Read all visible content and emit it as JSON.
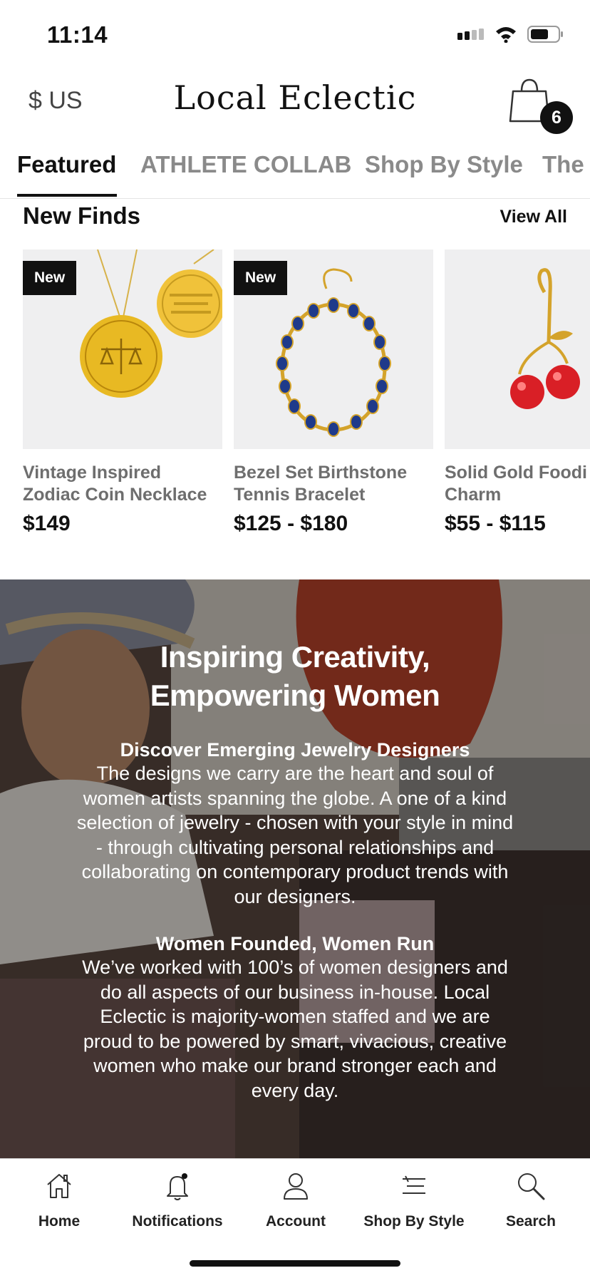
{
  "status_bar": {
    "time": "11:14"
  },
  "header": {
    "currency": "$ US",
    "brand": "Local Eclectic",
    "cart_count": "6"
  },
  "tabs": [
    {
      "label": "Featured"
    },
    {
      "label": "ATHLETE COLLAB"
    },
    {
      "label": "Shop By Style"
    },
    {
      "label": "The"
    }
  ],
  "new_finds": {
    "title": "New Finds",
    "view_all": "View All",
    "products": [
      {
        "badge": "New",
        "name_line1": "Vintage Inspired",
        "name_line2": "Zodiac Coin Necklace",
        "price": "$149"
      },
      {
        "badge": "New",
        "name_line1": "Bezel Set Birthstone",
        "name_line2": "Tennis Bracelet",
        "price": "$125 - $180"
      },
      {
        "badge": "",
        "name_line1": "Solid Gold Foodi",
        "name_line2": "Charm",
        "price": "$55 - $115"
      }
    ]
  },
  "hero": {
    "title_line1": "Inspiring Creativity,",
    "title_line2": "Empowering Women",
    "sub1": "Discover Emerging Jewelry Designers",
    "body1": "The designs we carry are the heart and soul of women artists spanning the globe. A one of a kind selection of jewelry - chosen with your style in mind - through cultivating personal relationships and collaborating on contemporary product trends with our designers.",
    "sub2": "Women Founded, Women Run",
    "body2": "We’ve worked with 100’s of women designers and do all aspects of our business in-house. Local Eclectic is majority-women staffed and we are proud to be powered by smart, vivacious, creative women who make our brand stronger each and every day."
  },
  "bottom_nav": [
    {
      "label": "Home",
      "icon": "home-icon"
    },
    {
      "label": "Notifications",
      "icon": "bell-icon"
    },
    {
      "label": "Account",
      "icon": "person-icon"
    },
    {
      "label": "Shop By Style",
      "icon": "menu-icon"
    },
    {
      "label": "Search",
      "icon": "search-icon"
    }
  ]
}
